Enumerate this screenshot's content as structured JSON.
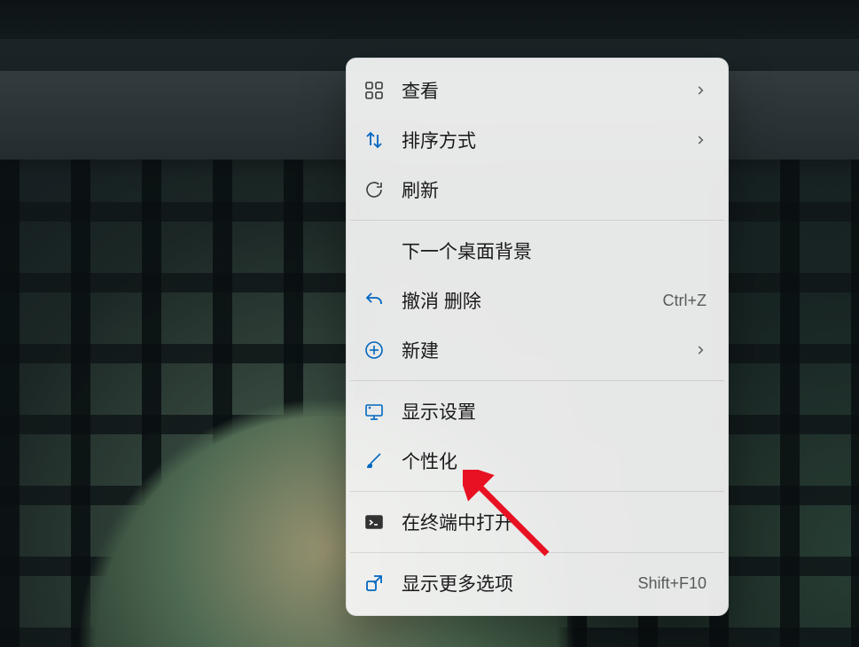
{
  "context_menu": {
    "view": {
      "label": "查看"
    },
    "sort": {
      "label": "排序方式"
    },
    "refresh": {
      "label": "刷新"
    },
    "next_bg": {
      "label": "下一个桌面背景"
    },
    "undo": {
      "label": "撤消 删除",
      "shortcut": "Ctrl+Z"
    },
    "new": {
      "label": "新建"
    },
    "display": {
      "label": "显示设置"
    },
    "personalize": {
      "label": "个性化"
    },
    "terminal": {
      "label": "在终端中打开"
    },
    "more": {
      "label": "显示更多选项",
      "shortcut": "Shift+F10"
    }
  }
}
